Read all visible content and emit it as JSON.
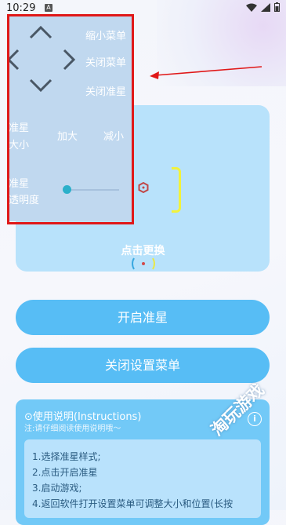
{
  "status_bar": {
    "time": "10:29",
    "notification_letter": "A"
  },
  "overlay_menu": {
    "shrink_menu": "缩小菜单",
    "close_menu": "关闭菜单",
    "close_crosshair": "关闭准星",
    "size_label_line1": "准星",
    "size_label_line2": "大小",
    "increase": "加大",
    "decrease": "减小",
    "opacity_label_line1": "准星",
    "opacity_label_line2": "透明度",
    "opacity_value": 0.08
  },
  "preview": {
    "click_change": "点击更换"
  },
  "buttons": {
    "open_crosshair": "开启准星",
    "close_settings_menu": "关闭设置菜单"
  },
  "instructions": {
    "title": "使用说明(Instructions)",
    "subtitle": "注:请仔细阅读使用说明哦～",
    "steps": [
      "1.选择准星样式;",
      "2.点击开启准星",
      "3.启动游戏;",
      "4.返回软件打开设置菜单可调整大小和位置(长按"
    ]
  },
  "watermark": "淘玩游戏",
  "colors": {
    "highlight_red": "#e01818",
    "button_blue": "#57bdf5",
    "card_blue": "#b8e2fb",
    "crosshair_yellow": "#f2f23c"
  }
}
